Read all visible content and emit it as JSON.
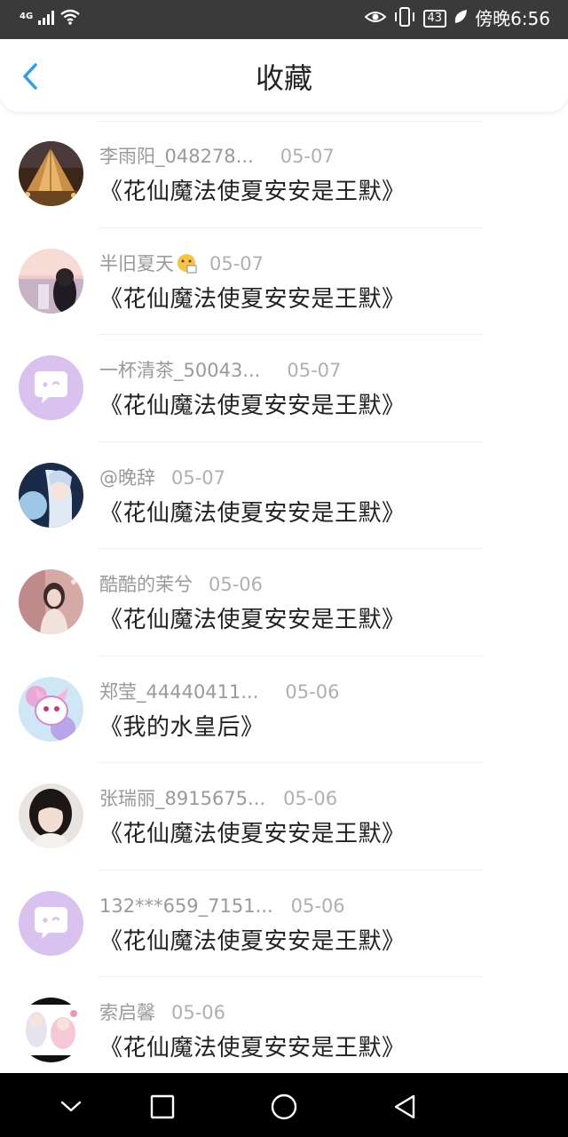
{
  "status_bar": {
    "network": "4G",
    "battery": "43",
    "time": "傍晚6:56",
    "icons": [
      "signal-icon",
      "wifi-icon",
      "eye-icon",
      "vibrate-icon",
      "battery-icon",
      "leaf-icon"
    ]
  },
  "header": {
    "title": "收藏",
    "back_icon": "chevron-left-icon"
  },
  "items": [
    {
      "user": "李雨阳_048278...",
      "date": "05-07",
      "title": "《花仙魔法使夏安安是王默》",
      "avatar": "photo-louvre"
    },
    {
      "user": "半旧夏天",
      "date": "05-07",
      "title": "《花仙魔法使夏安安是王默》",
      "avatar": "photo-girl-sunset",
      "badge": "emoji-icon"
    },
    {
      "user": "一杯清茶_50043...",
      "date": "05-07",
      "title": "《花仙魔法使夏安安是王默》",
      "avatar": "default-chat-avatar"
    },
    {
      "user": "@晚辞",
      "date": "05-07",
      "title": "《花仙魔法使夏安安是王默》",
      "avatar": "photo-anime-moon"
    },
    {
      "user": "酷酷的茉兮",
      "date": "05-06",
      "title": "《花仙魔法使夏安安是王默》",
      "avatar": "photo-girl-pink"
    },
    {
      "user": "郑莹_44440411...",
      "date": "05-06",
      "title": "《我的水皇后》",
      "avatar": "photo-anime-sprite"
    },
    {
      "user": "张瑞丽_8915675...",
      "date": "05-06",
      "title": "《花仙魔法使夏安安是王默》",
      "avatar": "photo-girl-dark-hair"
    },
    {
      "user": "132***659_7151...",
      "date": "05-06",
      "title": "《花仙魔法使夏安安是王默》",
      "avatar": "default-chat-avatar"
    },
    {
      "user": "索启馨",
      "date": "05-06",
      "title": "《花仙魔法使夏安安是王默》",
      "avatar": "photo-anime-girls"
    }
  ],
  "nav_bar": {
    "icons": [
      "nav-collapse-icon",
      "nav-recents-icon",
      "nav-home-icon",
      "nav-back-icon"
    ]
  },
  "colors": {
    "accent": "#2f9ef0",
    "default_avatar_bg": "#d9c2ef",
    "status_bar_bg": "#3a3a3a",
    "text_primary": "#222222",
    "text_secondary": "#9a9a9a"
  }
}
